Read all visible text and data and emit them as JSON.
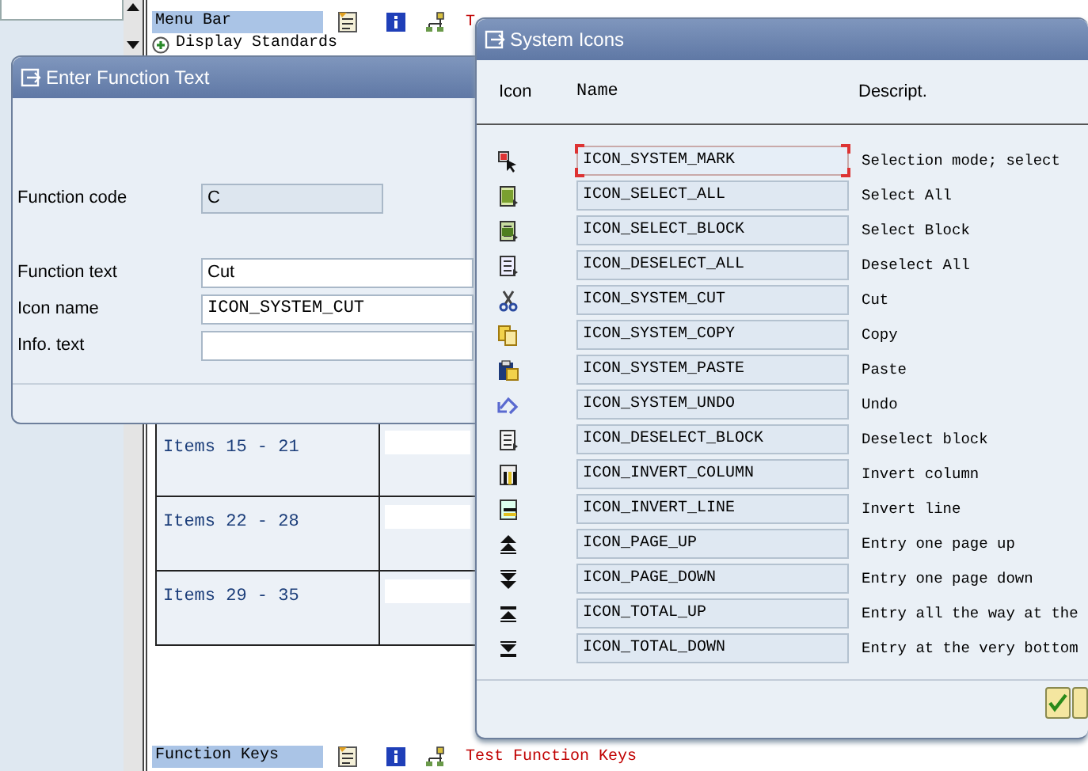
{
  "background": {
    "menu_row": {
      "label": "Menu Bar",
      "test_link": "T"
    },
    "sub_item": {
      "label": "Display Standards",
      "expanded": false
    },
    "item_rows": [
      {
        "label": "Items 15 - 21"
      },
      {
        "label": "Items 22 - 28"
      },
      {
        "label": "Items 29 - 35"
      }
    ],
    "footer_row": {
      "label": "Function Keys",
      "test_link": "Test Function Keys"
    }
  },
  "enter_function_text": {
    "title": "Enter Function Text",
    "fields": [
      {
        "label": "Function code",
        "value": "C",
        "disabled": true,
        "kind": "text"
      },
      {
        "label": "Function text",
        "value": "Cut",
        "disabled": false,
        "kind": "text"
      },
      {
        "label": "Icon name",
        "value": "ICON_SYSTEM_CUT",
        "disabled": false,
        "kind": "code"
      },
      {
        "label": "Info. text",
        "disabled": false,
        "kind": "text"
      }
    ]
  },
  "system_icons": {
    "title": "System Icons",
    "columns": [
      "Icon",
      "Name",
      "Descript."
    ],
    "rows": [
      {
        "name": "ICON_SYSTEM_MARK",
        "description": "Selection mode; select",
        "selected": true
      },
      {
        "name": "ICON_SELECT_ALL",
        "description": "Select All",
        "selected": false
      },
      {
        "name": "ICON_SELECT_BLOCK",
        "description": "Select Block",
        "selected": false
      },
      {
        "name": "ICON_DESELECT_ALL",
        "description": "Deselect All",
        "selected": false
      },
      {
        "name": "ICON_SYSTEM_CUT",
        "description": "Cut",
        "selected": false
      },
      {
        "name": "ICON_SYSTEM_COPY",
        "description": "Copy",
        "selected": false
      },
      {
        "name": "ICON_SYSTEM_PASTE",
        "description": "Paste",
        "selected": false
      },
      {
        "name": "ICON_SYSTEM_UNDO",
        "description": "Undo",
        "selected": false
      },
      {
        "name": "ICON_DESELECT_BLOCK",
        "description": "Deselect block",
        "selected": false
      },
      {
        "name": "ICON_INVERT_COLUMN",
        "description": "Invert column",
        "selected": false
      },
      {
        "name": "ICON_INVERT_LINE",
        "description": "Invert line",
        "selected": false
      },
      {
        "name": "ICON_PAGE_UP",
        "description": "Entry one page up",
        "selected": false
      },
      {
        "name": "ICON_PAGE_DOWN",
        "description": "Entry one page down",
        "selected": false
      },
      {
        "name": "ICON_TOTAL_UP",
        "description": "Entry all the way at the",
        "selected": false
      },
      {
        "name": "ICON_TOTAL_DOWN",
        "description": "Entry at the very bottom",
        "selected": false
      }
    ]
  }
}
